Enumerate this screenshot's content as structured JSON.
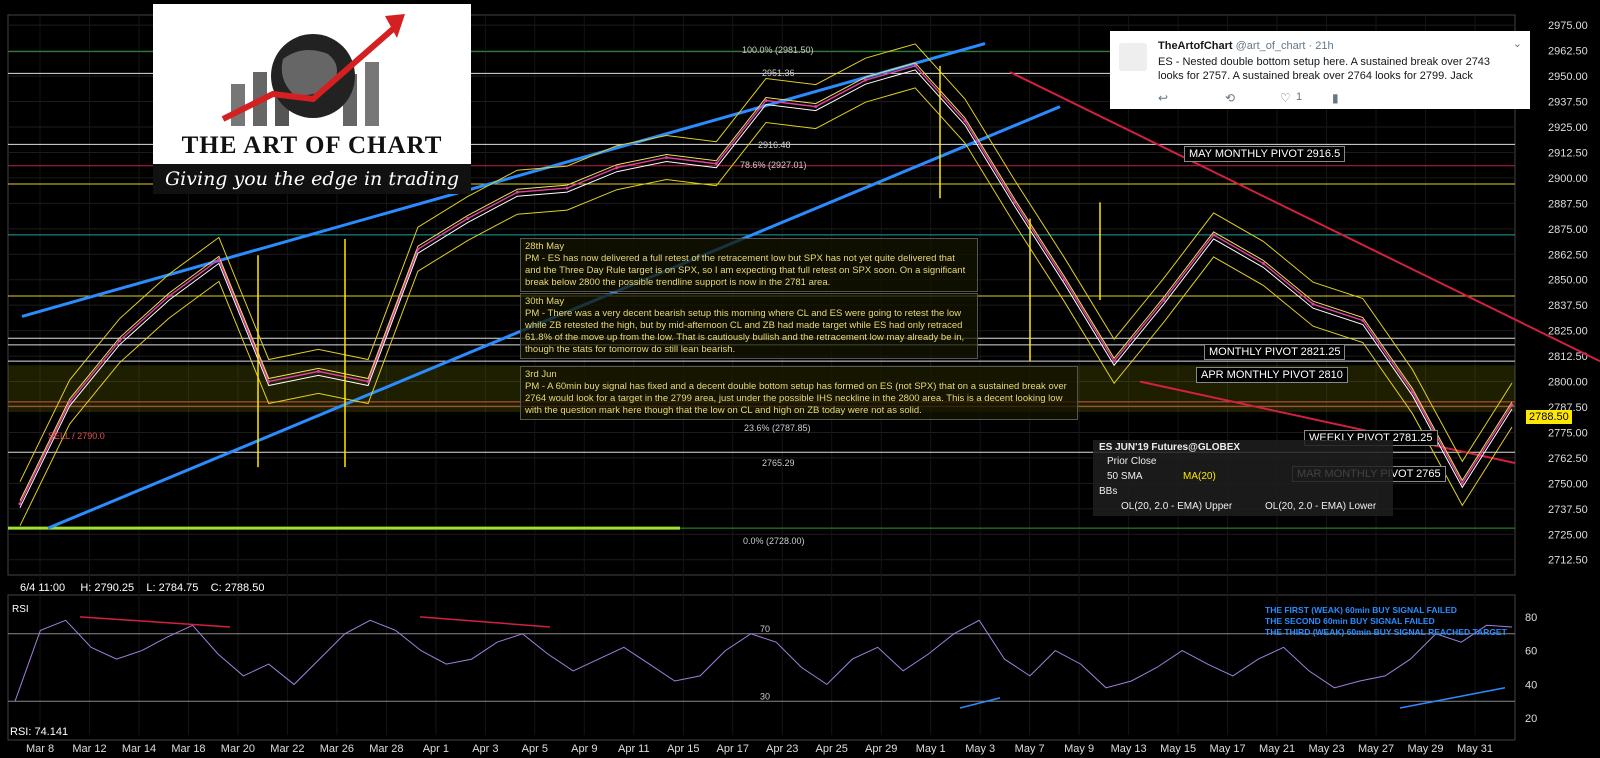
{
  "logo": {
    "title": "THE ART OF CHART",
    "tagline": "Giving you the edge in trading"
  },
  "tweet": {
    "name": "TheArtofChart",
    "handle": "@art_of_chart · 21h",
    "body": "ES - Nested double bottom setup here. A sustained break over 2743 looks for 2757. A sustained break over 2764 looks for 2799. Jack",
    "likes": "1",
    "reply_icon": "reply-icon",
    "retweet_icon": "retweet-icon",
    "like_icon": "heart-icon",
    "stats_icon": "stats-icon",
    "close_icon": "chevron-down-icon"
  },
  "notes": [
    {
      "head": "28th May",
      "body": "PM - ES has now delivered a full retest of the retracement low but SPX has not yet quite delivered that and the Three Day Rule target is on SPX, so I am expecting that full retest on SPX soon. On a significant break below 2800 the possible trendline support is now in the 2781 area."
    },
    {
      "head": "30th May",
      "body": "PM - There was a very decent bearish setup this morning where CL and ES were going to retest the low while ZB retested the high, but by mid-afternoon CL and ZB had made target while ES had only retraced 61.8% of the move up from the low. That is cautiously bullish and the retracement low may already be in, though the stats for tomorrow do still lean bearish."
    },
    {
      "head": "3rd Jun",
      "body": "PM - A 60min buy signal has fixed and a decent double bottom setup has formed on ES (not SPX) that on a sustained break over 2764 would look for a target in the 2799 area, just under the possible IHS neckline in the 2800 area. This is a decent looking low with the question mark here though  that the low on CL and high on ZB today were not as solid."
    }
  ],
  "levels": {
    "may_pivot": "MAY MONTHLY PIVOT 2916.5",
    "monthly_pivot": "MONTHLY PIVOT 2821.25",
    "apr_pivot": "APR MONTHLY PIVOT 2810",
    "weekly_pivot": "WEEKLY PIVOT 2781.25",
    "mar_pivot": "MAR MONTHLY PIVOT 2765",
    "fib100": "100.0% (2981.50)",
    "fib0": "0.0% (2728.00)",
    "lvl2951": "2951.36",
    "lvl2916": "2916.48",
    "lvl2765": "2765.29",
    "fib786": "78.6% (2927.01)",
    "fib236": "23.6% (2787.85)",
    "sell": "SELL / 2790.0"
  },
  "legend": {
    "title": "ES JUN'19 Futures@GLOBEX",
    "prior_close": "Prior Close",
    "sma": "50 SMA",
    "ma": "MA(20)",
    "bbs": "BBs",
    "upper": "OL(20, 2.0 - EMA) Upper",
    "lower": "OL(20, 2.0 - EMA) Lower"
  },
  "ohlc": {
    "date": "6/4 11:00",
    "high": "H: 2790.25",
    "low": "L: 2784.75",
    "close": "C: 2788.50"
  },
  "current_price": "2788.50",
  "rsi": {
    "label": "RSI",
    "value": "RSI: 74.141",
    "lvl70": "70",
    "lvl30": "30",
    "notes": [
      "THE FIRST (WEAK) 60min BUY SIGNAL FAILED",
      "THE SECOND 60min BUY SIGNAL FAILED",
      "THE THIRD (WEAK) 60min BUY SIGNAL REACHED TARGET"
    ],
    "yticks": [
      "80",
      "60",
      "40",
      "20"
    ]
  },
  "chart_data": {
    "type": "line",
    "title": "ES JUN'19 Futures@GLOBEX",
    "ylim": [
      2705,
      2980
    ],
    "yticks": [
      "2975.00",
      "2962.50",
      "2950.00",
      "2937.50",
      "2925.00",
      "2912.50",
      "2900.00",
      "2887.50",
      "2875.00",
      "2862.50",
      "2850.00",
      "2837.50",
      "2825.00",
      "2812.50",
      "2800.00",
      "2787.50",
      "2775.00",
      "2762.50",
      "2750.00",
      "2737.50",
      "2725.00",
      "2712.50"
    ],
    "xticks": [
      "Mar 8",
      "Mar 12",
      "Mar 14",
      "Mar 18",
      "Mar 20",
      "Mar 22",
      "Mar 26",
      "Mar 28",
      "Apr 1",
      "Apr 3",
      "Apr 5",
      "Apr 9",
      "Apr 11",
      "Apr 15",
      "Apr 17",
      "Apr 23",
      "Apr 25",
      "Apr 29",
      "May 1",
      "May 3",
      "May 7",
      "May 9",
      "May 13",
      "May 15",
      "May 17",
      "May 21",
      "May 23",
      "May 27",
      "May 29",
      "May 31"
    ],
    "series": [
      {
        "name": "ES JUN'19 Futures@GLOBEX",
        "x": [
          "Mar 8",
          "Mar 12",
          "Mar 14",
          "Mar 18",
          "Mar 20",
          "Mar 22",
          "Mar 26",
          "Mar 28",
          "Apr 1",
          "Apr 3",
          "Apr 5",
          "Apr 9",
          "Apr 11",
          "Apr 15",
          "Apr 17",
          "Apr 23",
          "Apr 25",
          "Apr 29",
          "May 1",
          "May 3",
          "May 7",
          "May 9",
          "May 13",
          "May 15",
          "May 17",
          "May 21",
          "May 23",
          "May 27",
          "May 29",
          "May 31",
          "Jun 4"
        ],
        "values": [
          2740,
          2790,
          2820,
          2842,
          2860,
          2800,
          2805,
          2800,
          2865,
          2880,
          2893,
          2895,
          2905,
          2910,
          2907,
          2938,
          2935,
          2948,
          2955,
          2928,
          2888,
          2850,
          2810,
          2840,
          2872,
          2858,
          2838,
          2830,
          2795,
          2750,
          2788.5
        ]
      }
    ],
    "rsi_ylim": [
      10,
      90
    ],
    "rsi_values": [
      30,
      72,
      78,
      62,
      55,
      60,
      68,
      75,
      58,
      45,
      52,
      40,
      55,
      70,
      78,
      72,
      60,
      52,
      55,
      65,
      70,
      58,
      48,
      55,
      62,
      52,
      42,
      45,
      60,
      70,
      65,
      50,
      40,
      55,
      62,
      48,
      58,
      70,
      78,
      55,
      45,
      60,
      52,
      38,
      42,
      50,
      60,
      52,
      45,
      55,
      62,
      48,
      38,
      42,
      45,
      55,
      70,
      65,
      75,
      74
    ]
  }
}
